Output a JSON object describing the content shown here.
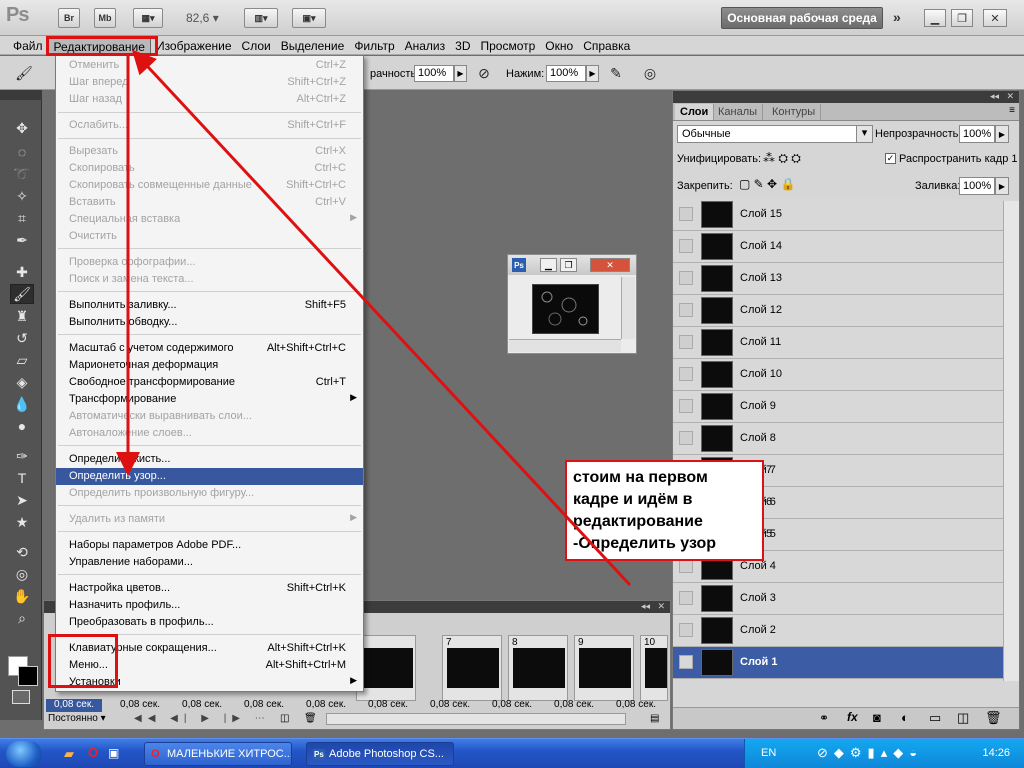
{
  "appbar": {
    "logo": "Ps",
    "bridge_label": "Br",
    "mini_bridge_label": "Mb",
    "zoom": "82,6",
    "workspace": "Основная рабочая среда",
    "more": "»"
  },
  "menubar": [
    "Файл",
    "Редактирование",
    "Изображение",
    "Слои",
    "Выделение",
    "Фильтр",
    "Анализ",
    "3D",
    "Просмотр",
    "Окно",
    "Справка"
  ],
  "options": {
    "opacity_label": "рачность:",
    "opacity_value": "100%",
    "press_label": "Нажим:",
    "press_value": "100%"
  },
  "edit_menu": [
    {
      "label": "Отменить",
      "shortcut": "Ctrl+Z",
      "disabled": true
    },
    {
      "label": "Шаг вперед",
      "shortcut": "Shift+Ctrl+Z",
      "disabled": true
    },
    {
      "label": "Шаг назад",
      "shortcut": "Alt+Ctrl+Z",
      "disabled": true
    },
    {
      "label": "Ослабить...",
      "shortcut": "Shift+Ctrl+F",
      "disabled": true
    },
    {
      "label": "Вырезать",
      "shortcut": "Ctrl+X",
      "disabled": true
    },
    {
      "label": "Скопировать",
      "shortcut": "Ctrl+C",
      "disabled": true
    },
    {
      "label": "Скопировать совмещенные данные",
      "shortcut": "Shift+Ctrl+C",
      "disabled": true
    },
    {
      "label": "Вставить",
      "shortcut": "Ctrl+V",
      "disabled": true
    },
    {
      "label": "Специальная вставка",
      "shortcut": "",
      "disabled": true
    },
    {
      "label": "Очистить",
      "shortcut": "",
      "disabled": true
    },
    {
      "label": "Проверка орфографии...",
      "shortcut": "",
      "disabled": true
    },
    {
      "label": "Поиск и замена текста...",
      "shortcut": "",
      "disabled": true
    },
    {
      "label": "Выполнить заливку...",
      "shortcut": "Shift+F5",
      "disabled": false
    },
    {
      "label": "Выполнить обводку...",
      "shortcut": "",
      "disabled": false
    },
    {
      "label": "Масштаб с учетом содержимого",
      "shortcut": "Alt+Shift+Ctrl+C",
      "disabled": false
    },
    {
      "label": "Марионеточная деформация",
      "shortcut": "",
      "disabled": false
    },
    {
      "label": "Свободное трансформирование",
      "shortcut": "Ctrl+T",
      "disabled": false
    },
    {
      "label": "Трансформирование",
      "shortcut": "",
      "disabled": false
    },
    {
      "label": "Автоматически выравнивать слои...",
      "shortcut": "",
      "disabled": true
    },
    {
      "label": "Автоналожение слоев...",
      "shortcut": "",
      "disabled": true
    },
    {
      "label": "Определить кисть...",
      "shortcut": "",
      "disabled": false
    },
    {
      "label": "Определить узор...",
      "shortcut": "",
      "disabled": false
    },
    {
      "label": "Определить произвольную фигуру...",
      "shortcut": "",
      "disabled": true
    },
    {
      "label": "Удалить из памяти",
      "shortcut": "",
      "disabled": true
    },
    {
      "label": "Наборы параметров Adobe PDF...",
      "shortcut": "",
      "disabled": false
    },
    {
      "label": "Управление наборами...",
      "shortcut": "",
      "disabled": false
    },
    {
      "label": "Настройка цветов...",
      "shortcut": "Shift+Ctrl+K",
      "disabled": false
    },
    {
      "label": "Назначить профиль...",
      "shortcut": "",
      "disabled": false
    },
    {
      "label": "Преобразовать в профиль...",
      "shortcut": "",
      "disabled": false
    },
    {
      "label": "Клавиатурные сокращения...",
      "shortcut": "Alt+Shift+Ctrl+K",
      "disabled": false
    },
    {
      "label": "Меню...",
      "shortcut": "Alt+Shift+Ctrl+M",
      "disabled": false
    },
    {
      "label": "Установки",
      "shortcut": "",
      "disabled": false
    }
  ],
  "layers_panel": {
    "tabs": [
      "Слои",
      "Каналы",
      "Контуры"
    ],
    "blend_mode": "Обычные",
    "opacity_label": "Непрозрачность:",
    "opacity_value": "100%",
    "unify_label": "Унифицировать:",
    "propagate_label": "Распространить кадр 1",
    "lock_label": "Закрепить:",
    "fill_label": "Заливка:",
    "fill_value": "100%",
    "layers": [
      "Слой 15",
      "Слой 14",
      "Слой 13",
      "Слой 12",
      "Слой 11",
      "Слой 10",
      "Слой 9",
      "Слой 8",
      "Слой 7",
      "Слой 6",
      "Слой 5",
      "Слой 4",
      "Слой 3",
      "Слой 2",
      "Слой 1"
    ],
    "visible_digits": [
      "7",
      "6",
      "5"
    ]
  },
  "animation": {
    "frame_numbers": [
      "7",
      "8",
      "9",
      "10"
    ],
    "delays": [
      "0,08 сек.",
      "0,08 сек.",
      "0,08 сек.",
      "0,08 сек.",
      "0,08 сек.",
      "0,08 сек.",
      "0,08 сек.",
      "0,08 сек.",
      "0,08 сек.",
      "0,08 сек."
    ],
    "loop": "Постоянно"
  },
  "annotation": {
    "line1": "стоим на первом",
    "line2": "кадре  и идём в",
    "line3": "редактирование",
    "line4": "-Определить узор"
  },
  "taskbar": {
    "task1": "МАЛЕНЬКИЕ ХИТРОС...",
    "task2": "Adobe Photoshop CS...",
    "lang": "EN",
    "time": "14:26"
  },
  "colors": {
    "accent": "#37589f",
    "annotation": "#d11111"
  }
}
